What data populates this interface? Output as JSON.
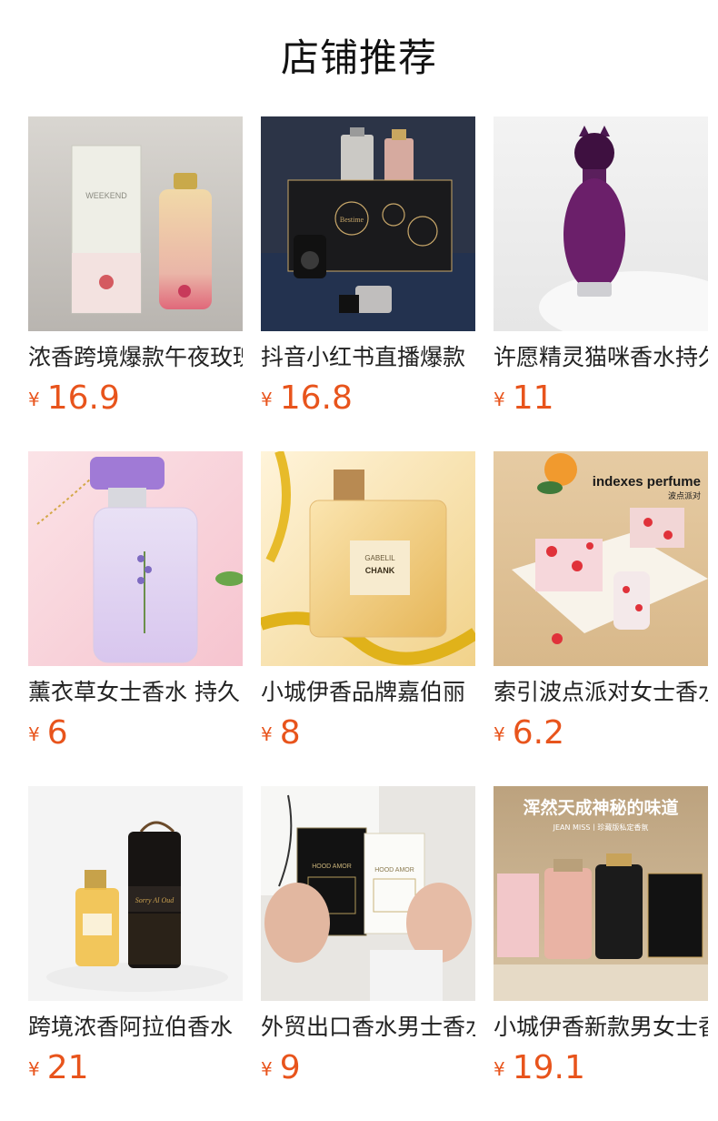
{
  "section_title": "店铺推荐",
  "currency_symbol": "¥",
  "accent_color": "#e8541c",
  "products": [
    {
      "name": "浓香跨境爆款午夜玫瑰",
      "price": "16.9"
    },
    {
      "name": "抖音小红书直播爆款",
      "price": "16.8"
    },
    {
      "name": "许愿精灵猫咪香水持久",
      "price": "11"
    },
    {
      "name": "薰衣草女士香水 持久",
      "price": "6"
    },
    {
      "name": "小城伊香品牌嘉伯丽",
      "price": "8"
    },
    {
      "name": "索引波点派对女士香水",
      "price": "6.2"
    },
    {
      "name": "跨境浓香阿拉伯香水",
      "price": "21"
    },
    {
      "name": "外贸出口香水男士香水",
      "price": "9"
    },
    {
      "name": "小城伊香新款男女士香",
      "price": "19.1"
    }
  ],
  "image_text": {
    "p1_box": "WEEKEND",
    "p2_box": "Bestime",
    "p5_label": "GABELIL",
    "p5_label2": "CHANK",
    "p6_headline": "indexes perfume",
    "p6_sub": "波点派对",
    "p7_label": "Sorry Al Oud",
    "p8_label": "HOOD AMOR",
    "p9_headline": "浑然天成神秘的味道",
    "p9_sub": "JEAN MISS丨珍藏版私定香氛"
  }
}
